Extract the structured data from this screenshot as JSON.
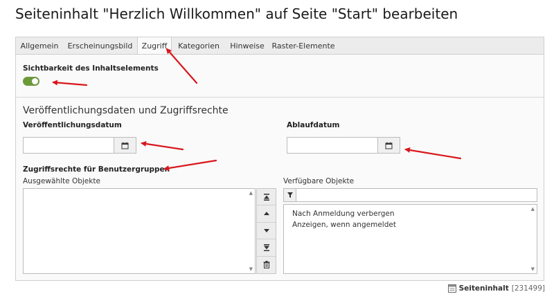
{
  "page": {
    "title": "Seiteninhalt \"Herzlich Willkommen\" auf Seite \"Start\" bearbeiten"
  },
  "tabs": [
    {
      "label": "Allgemein",
      "active": false
    },
    {
      "label": "Erscheinungsbild",
      "active": false
    },
    {
      "label": "Zugriff",
      "active": true
    },
    {
      "label": "Kategorien",
      "active": false
    },
    {
      "label": "Hinweise",
      "active": false
    },
    {
      "label": "Raster-Elemente",
      "active": false
    }
  ],
  "visibility": {
    "label": "Sichtbarkeit des Inhaltselements",
    "enabled": true
  },
  "access_section": {
    "heading": "Veröffentlichungsdaten und Zugriffsrechte",
    "publish_date_label": "Veröffentlichungsdatum",
    "publish_date_value": "",
    "expiry_date_label": "Ablaufdatum",
    "expiry_date_value": "",
    "usergroups_label": "Zugriffsrechte für Benutzergruppen",
    "selected_label": "Ausgewählte Objekte",
    "selected_items": [],
    "available_label": "Verfügbare Objekte",
    "filter_value": "",
    "available_items": [
      "Nach Anmeldung verbergen",
      "Anzeigen, wenn angemeldet"
    ]
  },
  "footer": {
    "record_type": "Seiteninhalt",
    "record_uid": "[231499]"
  },
  "colors": {
    "toggle_on": "#6c9a3b",
    "annotation_arrow": "#d9161b"
  },
  "icons": [
    "calendar-icon",
    "move-top-icon",
    "move-up-icon",
    "move-down-icon",
    "move-bottom-icon",
    "trash-icon",
    "filter-icon",
    "record-icon"
  ]
}
